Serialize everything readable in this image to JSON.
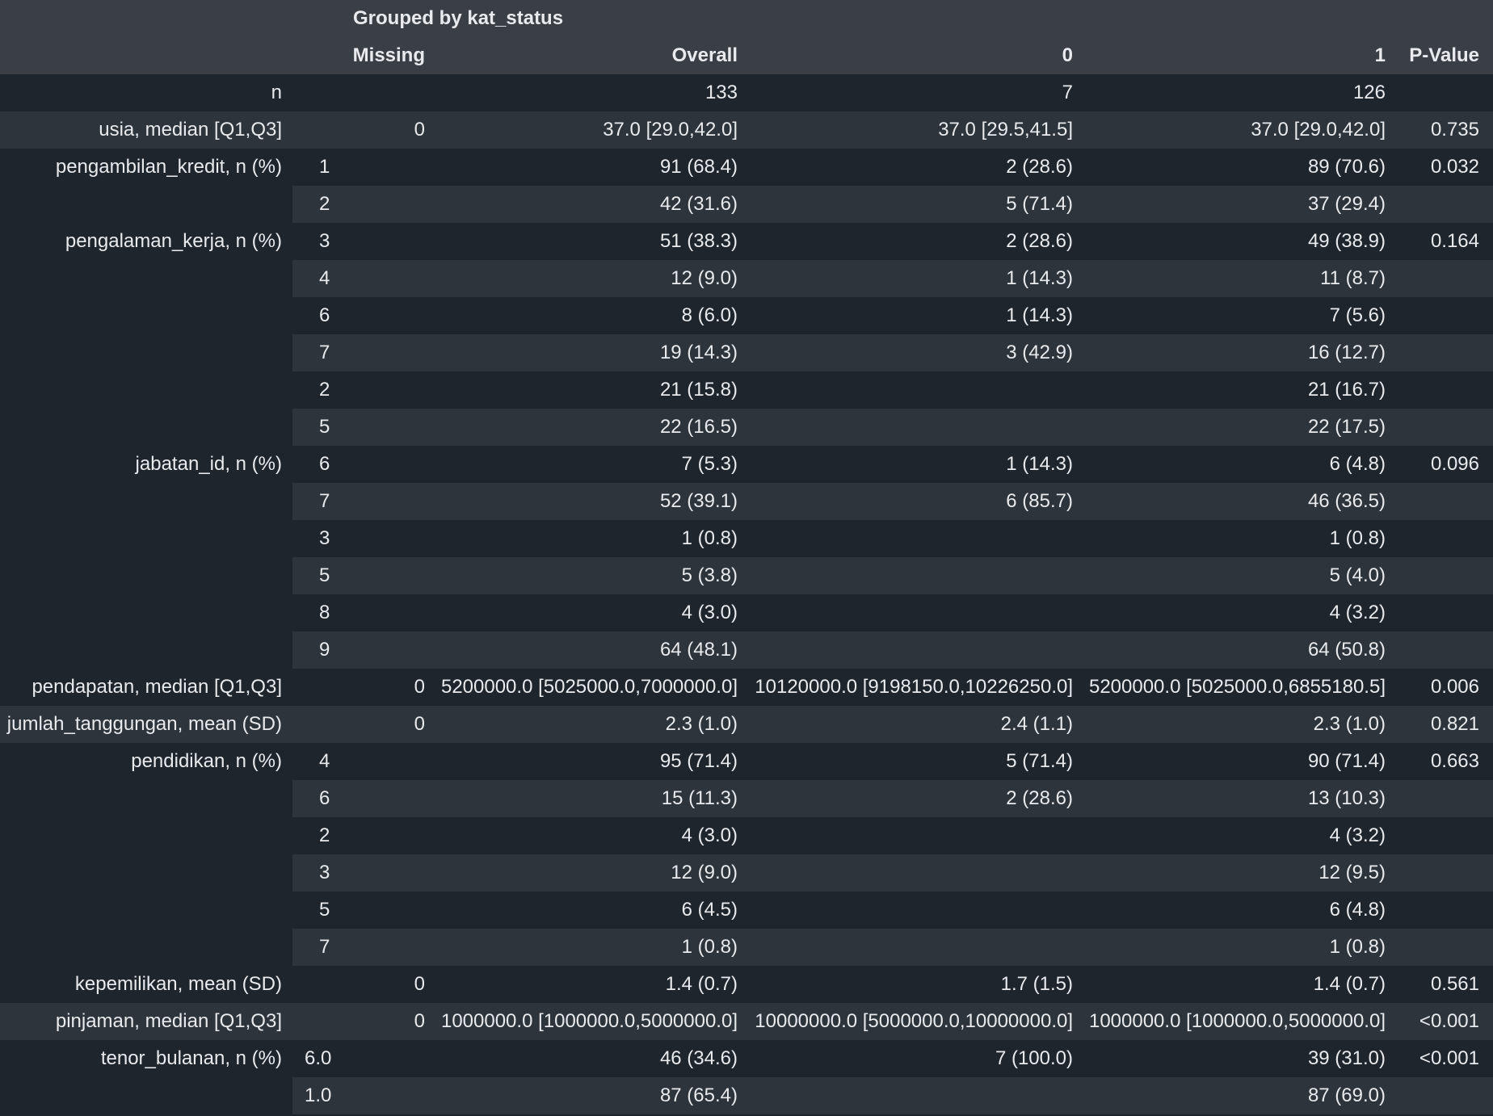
{
  "title": "Grouped by kat_status",
  "header": {
    "missing": "Missing",
    "overall": "Overall",
    "group0": "0",
    "group1": "1",
    "pvalue": "P-Value"
  },
  "rows": [
    {
      "label": "n",
      "level": "",
      "missing": "",
      "overall": "133",
      "g0": "7",
      "g1": "126",
      "p": ""
    },
    {
      "label": "usia, median [Q1,Q3]",
      "level": "",
      "missing": "0",
      "overall": "37.0 [29.0,42.0]",
      "g0": "37.0 [29.5,41.5]",
      "g1": "37.0 [29.0,42.0]",
      "p": "0.735"
    },
    {
      "label": "pengambilan_kredit, n (%)",
      "level": "1",
      "missing": "",
      "overall": "91 (68.4)",
      "g0": "2 (28.6)",
      "g1": "89 (70.6)",
      "p": "0.032"
    },
    {
      "label": "",
      "level": "2",
      "missing": "",
      "overall": "42 (31.6)",
      "g0": "5 (71.4)",
      "g1": "37 (29.4)",
      "p": ""
    },
    {
      "label": "pengalaman_kerja, n (%)",
      "level": "3",
      "missing": "",
      "overall": "51 (38.3)",
      "g0": "2 (28.6)",
      "g1": "49 (38.9)",
      "p": "0.164"
    },
    {
      "label": "",
      "level": "4",
      "missing": "",
      "overall": "12 (9.0)",
      "g0": "1 (14.3)",
      "g1": "11 (8.7)",
      "p": ""
    },
    {
      "label": "",
      "level": "6",
      "missing": "",
      "overall": "8 (6.0)",
      "g0": "1 (14.3)",
      "g1": "7 (5.6)",
      "p": ""
    },
    {
      "label": "",
      "level": "7",
      "missing": "",
      "overall": "19 (14.3)",
      "g0": "3 (42.9)",
      "g1": "16 (12.7)",
      "p": ""
    },
    {
      "label": "",
      "level": "2",
      "missing": "",
      "overall": "21 (15.8)",
      "g0": "",
      "g1": "21 (16.7)",
      "p": ""
    },
    {
      "label": "",
      "level": "5",
      "missing": "",
      "overall": "22 (16.5)",
      "g0": "",
      "g1": "22 (17.5)",
      "p": ""
    },
    {
      "label": "jabatan_id, n (%)",
      "level": "6",
      "missing": "",
      "overall": "7 (5.3)",
      "g0": "1 (14.3)",
      "g1": "6 (4.8)",
      "p": "0.096"
    },
    {
      "label": "",
      "level": "7",
      "missing": "",
      "overall": "52 (39.1)",
      "g0": "6 (85.7)",
      "g1": "46 (36.5)",
      "p": ""
    },
    {
      "label": "",
      "level": "3",
      "missing": "",
      "overall": "1 (0.8)",
      "g0": "",
      "g1": "1 (0.8)",
      "p": ""
    },
    {
      "label": "",
      "level": "5",
      "missing": "",
      "overall": "5 (3.8)",
      "g0": "",
      "g1": "5 (4.0)",
      "p": ""
    },
    {
      "label": "",
      "level": "8",
      "missing": "",
      "overall": "4 (3.0)",
      "g0": "",
      "g1": "4 (3.2)",
      "p": ""
    },
    {
      "label": "",
      "level": "9",
      "missing": "",
      "overall": "64 (48.1)",
      "g0": "",
      "g1": "64 (50.8)",
      "p": ""
    },
    {
      "label": "pendapatan, median [Q1,Q3]",
      "level": "",
      "missing": "0",
      "overall": "5200000.0 [5025000.0,7000000.0]",
      "g0": "10120000.0 [9198150.0,10226250.0]",
      "g1": "5200000.0 [5025000.0,6855180.5]",
      "p": "0.006"
    },
    {
      "label": "jumlah_tanggungan, mean (SD)",
      "level": "",
      "missing": "0",
      "overall": "2.3 (1.0)",
      "g0": "2.4 (1.1)",
      "g1": "2.3 (1.0)",
      "p": "0.821"
    },
    {
      "label": "pendidikan, n (%)",
      "level": "4",
      "missing": "",
      "overall": "95 (71.4)",
      "g0": "5 (71.4)",
      "g1": "90 (71.4)",
      "p": "0.663"
    },
    {
      "label": "",
      "level": "6",
      "missing": "",
      "overall": "15 (11.3)",
      "g0": "2 (28.6)",
      "g1": "13 (10.3)",
      "p": ""
    },
    {
      "label": "",
      "level": "2",
      "missing": "",
      "overall": "4 (3.0)",
      "g0": "",
      "g1": "4 (3.2)",
      "p": ""
    },
    {
      "label": "",
      "level": "3",
      "missing": "",
      "overall": "12 (9.0)",
      "g0": "",
      "g1": "12 (9.5)",
      "p": ""
    },
    {
      "label": "",
      "level": "5",
      "missing": "",
      "overall": "6 (4.5)",
      "g0": "",
      "g1": "6 (4.8)",
      "p": ""
    },
    {
      "label": "",
      "level": "7",
      "missing": "",
      "overall": "1 (0.8)",
      "g0": "",
      "g1": "1 (0.8)",
      "p": ""
    },
    {
      "label": "kepemilikan, mean (SD)",
      "level": "",
      "missing": "0",
      "overall": "1.4 (0.7)",
      "g0": "1.7 (1.5)",
      "g1": "1.4 (0.7)",
      "p": "0.561"
    },
    {
      "label": "pinjaman, median [Q1,Q3]",
      "level": "",
      "missing": "0",
      "overall": "1000000.0 [1000000.0,5000000.0]",
      "g0": "10000000.0 [5000000.0,10000000.0]",
      "g1": "1000000.0 [1000000.0,5000000.0]",
      "p": "<0.001"
    },
    {
      "label": "tenor_bulanan, n (%)",
      "level": "6.0",
      "missing": "",
      "overall": "46 (34.6)",
      "g0": "7 (100.0)",
      "g1": "39 (31.0)",
      "p": "<0.001"
    },
    {
      "label": "",
      "level": "1.0",
      "missing": "",
      "overall": "87 (65.4)",
      "g0": "",
      "g1": "87 (69.0)",
      "p": ""
    }
  ]
}
